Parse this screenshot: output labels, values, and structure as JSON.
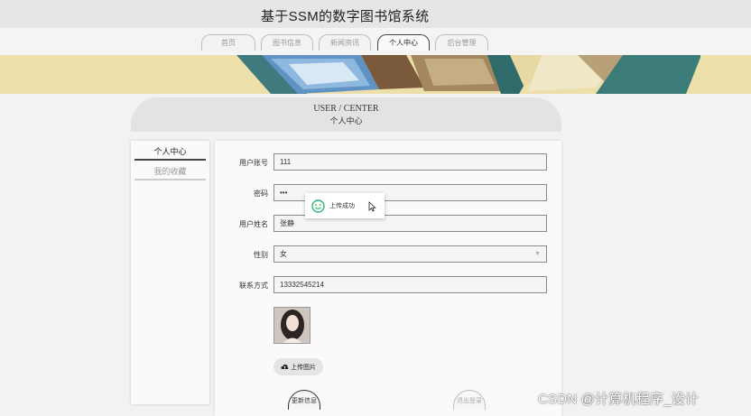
{
  "site": {
    "title": "基于SSM的数字图书馆系统"
  },
  "nav": {
    "tabs": [
      {
        "label": "首页"
      },
      {
        "label": "图书信息"
      },
      {
        "label": "新闻资讯"
      },
      {
        "label": "个人中心"
      },
      {
        "label": "后台管理"
      }
    ],
    "active_index": 3
  },
  "center": {
    "title_en": "USER / CENTER",
    "title_cn": "个人中心"
  },
  "sidebar": {
    "items": [
      {
        "label": "个人中心"
      },
      {
        "label": "我的收藏"
      }
    ]
  },
  "form": {
    "account_label": "用户账号",
    "account_value": "111",
    "password_label": "密码",
    "password_value": "•••",
    "name_label": "用户姓名",
    "name_value": "张静",
    "gender_label": "性别",
    "gender_value": "女",
    "contact_label": "联系方式",
    "contact_value": "13332545214",
    "upload_label": "上传图片",
    "update_label": "更新信息",
    "logout_label": "退出登录"
  },
  "toast": {
    "message": "上传成功"
  },
  "watermark": {
    "text": "CSDN @计算机程序_设计"
  },
  "colors": {
    "banner_bg": "#ecdfa9",
    "success": "#2eb872",
    "active_border": "#444444"
  },
  "icons": [
    "smile-icon",
    "cloud-upload-icon",
    "chevron-down-icon",
    "cursor-icon"
  ]
}
